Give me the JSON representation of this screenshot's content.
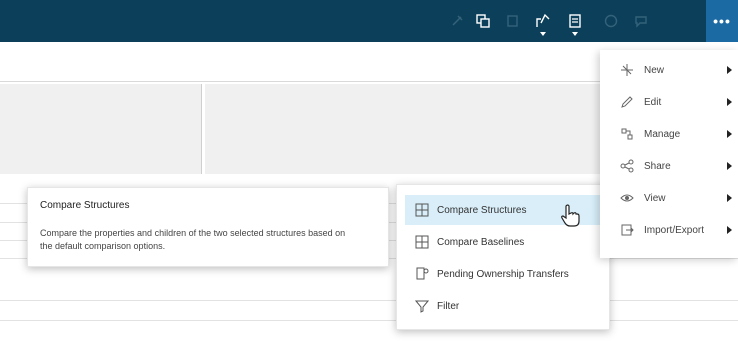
{
  "toolbar": {
    "icons": [
      "pin-icon",
      "copy-icon",
      "duplicate-icon",
      "compare-icon",
      "report-icon",
      "history-icon",
      "chat-icon"
    ],
    "more_label": "•••"
  },
  "context_menu": {
    "items": [
      {
        "label": "New",
        "icon": "sparkle-icon"
      },
      {
        "label": "Edit",
        "icon": "pencil-icon"
      },
      {
        "label": "Manage",
        "icon": "manage-icon"
      },
      {
        "label": "Share",
        "icon": "share-icon"
      },
      {
        "label": "View",
        "icon": "eye-icon"
      },
      {
        "label": "Import/Export",
        "icon": "import-export-icon"
      }
    ]
  },
  "submenu": {
    "items": [
      {
        "label": "Compare Structures",
        "icon": "compare-structures-icon"
      },
      {
        "label": "Compare Baselines",
        "icon": "compare-baselines-icon"
      },
      {
        "label": "Pending Ownership Transfers",
        "icon": "ownership-transfer-icon"
      },
      {
        "label": "Filter",
        "icon": "filter-icon"
      }
    ]
  },
  "tooltip": {
    "title": "Compare Structures",
    "description": "Compare the properties and children of the two selected structures based on the default comparison options."
  },
  "colors": {
    "topbar": "#0c3f5a",
    "more_button": "#1c6aa3",
    "highlight": "#d9eef9"
  }
}
